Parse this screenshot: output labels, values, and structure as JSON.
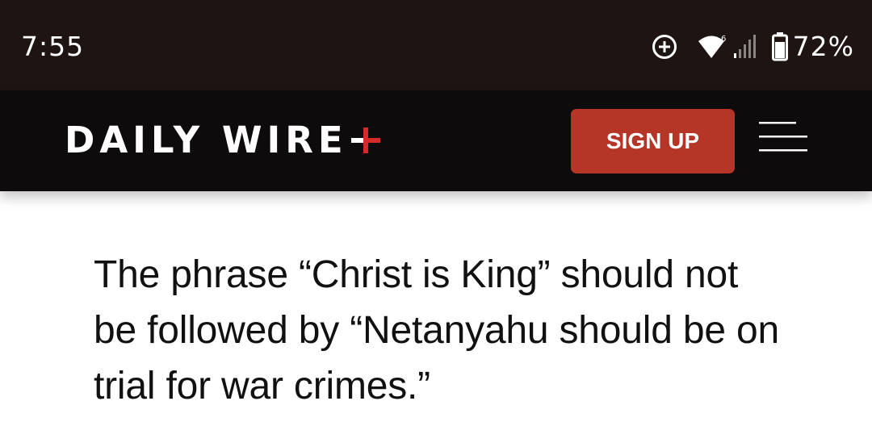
{
  "status_bar": {
    "time": "7:55",
    "battery_percent": "72%",
    "icons": [
      "data-saver-icon",
      "wifi-icon",
      "signal-icon",
      "battery-icon"
    ],
    "background": "#1e1513"
  },
  "header": {
    "logo_text": "DAILY WIRE",
    "logo_plus_color": "#d42a2a",
    "signup_label": "SIGN UP",
    "signup_color": "#b53527",
    "menu_icon": "hamburger-menu-icon",
    "background": "#0d0b0b"
  },
  "article": {
    "text": "The phrase “Christ is King” should not be followed by “Netanyahu should be on trial for war crimes.”"
  }
}
